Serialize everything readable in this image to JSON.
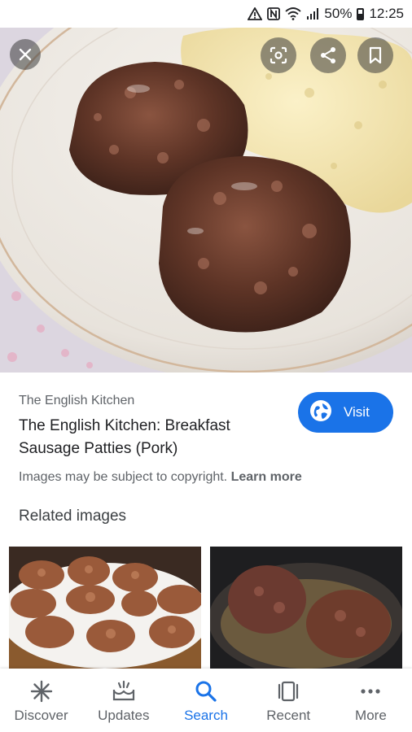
{
  "status_bar": {
    "battery": "50%",
    "time": "12:25"
  },
  "detail": {
    "source": "The English Kitchen",
    "title": "The English Kitchen: Breakfast Sausage Patties (Pork)",
    "visit_label": "Visit",
    "copyright_text": "Images may be subject to copyright.",
    "learn_more": "Learn more"
  },
  "related": {
    "heading": "Related images"
  },
  "bottom_nav": {
    "items": [
      {
        "label": "Discover",
        "icon": "asterisk-icon"
      },
      {
        "label": "Updates",
        "icon": "updates-icon"
      },
      {
        "label": "Search",
        "icon": "search-icon",
        "active": true
      },
      {
        "label": "Recent",
        "icon": "recent-icon"
      },
      {
        "label": "More",
        "icon": "more-dots-icon"
      }
    ]
  },
  "colors": {
    "accent": "#1a73e8",
    "text_primary": "#202124",
    "text_secondary": "#5f6368"
  }
}
